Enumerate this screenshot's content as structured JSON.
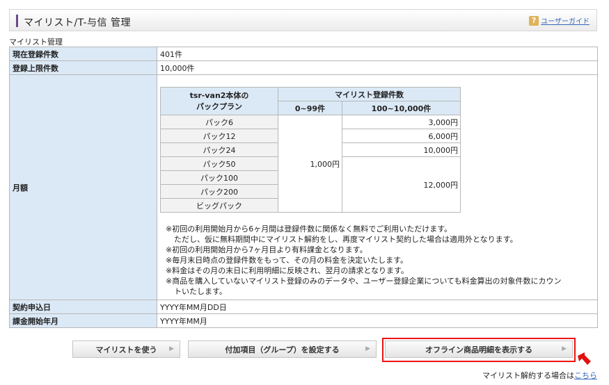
{
  "header": {
    "title": "マイリスト/T-与信 管理",
    "help_icon": "?",
    "guide_link": "ユーザーガイド"
  },
  "section_title": "マイリスト管理",
  "rows": {
    "registered": {
      "label": "現在登録件数",
      "value": "401件"
    },
    "limit": {
      "label": "登録上限件数",
      "value": "10,000件"
    },
    "monthly_label": "月額",
    "apply_date": {
      "label": "契約申込日",
      "value": "YYYY年MM月DD日"
    },
    "billing_start": {
      "label": "課金開始年月",
      "value": "YYYY年MM月"
    }
  },
  "price_table": {
    "header_plan": "tsr-van2本体の\nパックプラン",
    "header_count": "マイリスト登録件数",
    "header_col1": "0~99件",
    "header_col2": "100~10,000件",
    "plans": [
      "パック6",
      "パック12",
      "パック24",
      "パック50",
      "パック100",
      "パック200",
      "ビッグパック"
    ],
    "col1_value": "1,000円",
    "col2_values": [
      "3,000円",
      "6,000円",
      "10,000円"
    ],
    "col2_big_value": "12,000円"
  },
  "notes": [
    "※初回の利用開始月から6ヶ月間は登録件数に関係なく無料でご利用いただけます。",
    "ただし、仮に無料期間中にマイリスト解約をし、再度マイリスト契約した場合は適用外となります。",
    "※初回の利用開始月から7ヶ月目より有料課金となります。",
    "※毎月末日時点の登録件数をもって、その月の料金を決定いたします。",
    "※料金はその月の末日に利用明細に反映され、翌月の請求となります。",
    "※商品を購入していないマイリスト登録のみのデータや、ユーザー登録企業についても料金算出の対象件数にカウン",
    "トいたします。"
  ],
  "buttons": {
    "use_mylist": "マイリストを使う",
    "set_group": "付加項目（グループ）を設定する",
    "offline": "オフライン商品明細を表示する"
  },
  "footer": {
    "text": "マイリスト解約する場合は",
    "link": "こちら"
  },
  "colors": {
    "label_bg": "#dbe9f6",
    "highlight": "#ee1111",
    "accent": "#6a4a8c"
  }
}
